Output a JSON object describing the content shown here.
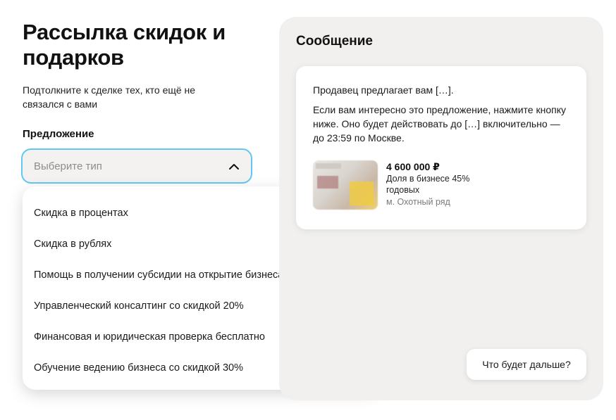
{
  "left": {
    "title": "Рассылка скидок и подарков",
    "subtitle": "Подтолкните к сделке тех, кто ещё не связался с вами",
    "offer_label": "Предложение",
    "select": {
      "placeholder": "Выберите тип",
      "icon": "chevron-up-icon"
    },
    "dropdown": {
      "items": [
        "Скидка в процентах",
        "Скидка в рублях",
        "Помощь в получении субсидии на открытие бизнеса бесплатно",
        "Управленческий консалтинг со скидкой 20%",
        "Финансовая и юридическая проверка бесплатно",
        "Обучение ведению бизнеса со скидкой 30%"
      ]
    }
  },
  "panel": {
    "title": "Сообщение",
    "message": {
      "line1": "Продавец предлагает вам […].",
      "line2": "Если вам интересно это предложение, нажмите кнопку ниже. Оно будет действовать до […] включительно — до 23:59 по Москве."
    },
    "listing": {
      "price": "4 600 000 ₽",
      "description": "Доля в бизнесе 45% годовых",
      "metro": "м. Охотный ряд"
    },
    "next_button": "Что будет дальше?"
  },
  "colors": {
    "focus_border": "#63c7f2",
    "panel_bg": "#f1f0ee"
  }
}
